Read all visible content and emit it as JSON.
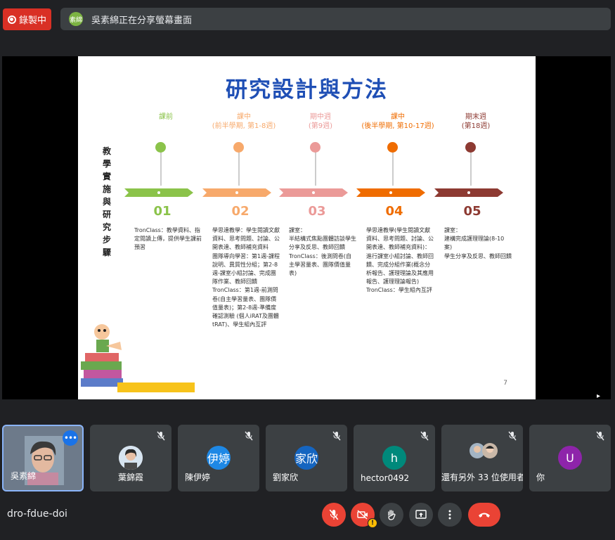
{
  "recording": {
    "label": "錄製中"
  },
  "share_banner": {
    "avatar_text": "素綿",
    "text": "吳素綿正在分享螢幕畫面"
  },
  "slide": {
    "title": "研究設計與方法",
    "side_label": "教學實施與研究步驟",
    "page_number": "7",
    "stages": [
      {
        "phase": "課前",
        "num": "01",
        "color": "#8bc34a",
        "desc": "TronClass：教學資料、指定閱讀上傳，提供學生課前預習"
      },
      {
        "phase": "課中\n(前半學期, 第1-8週)",
        "num": "02",
        "color": "#f7a96b",
        "desc": "學思達教學：學生閱讀文獻資料、思考問題、討論、公開表達、教師補充資料\n團隊導向學習：第1週-課程說明、異質性分組；第2-8週-課室小組討論、完成團隊作業、教師回饋\nTronClass：第1週-前測問卷(自主學習量表、團隊價值量表)；第2-8週-準備度確認測驗 (個人iRAT及團體tRAT)、學生組內互評"
      },
      {
        "phase": "期中週\n(第9週)",
        "num": "03",
        "color": "#eb9a98",
        "desc": "課室：\n半結構式焦點團體訪談學生分享及反思、教師回饋\n TronClass：後測問卷(自主學習量表、團隊價值量表)"
      },
      {
        "phase": "課中\n(後半學期, 第10-17週)",
        "num": "04",
        "color": "#ef6c00",
        "desc": "學思達教學(學生閱讀文獻資料、思考問題、討論、公開表達、教師補充資料)：進行課室小組討論、教師回饋、完成分組作業(概念分析報告、護理理論及其應用報告、護理理論報告)\nTronClass：學生組內互評"
      },
      {
        "phase": "期末週\n(第18週)",
        "num": "05",
        "color": "#8d3a32",
        "desc": "課室：\n建構完成護理理論(8-10案)\n學生分享及反思、教師回饋"
      }
    ]
  },
  "participants": [
    {
      "name": "吳素綿",
      "type": "video",
      "self_options_icon": "more-vert-icon"
    },
    {
      "name": "葉錦霞",
      "type": "photo",
      "muted": true
    },
    {
      "name": "陳伊婷",
      "type": "initial",
      "initial": "伊婷",
      "color": "#1e88e5",
      "muted": true
    },
    {
      "name": "劉家欣",
      "type": "initial",
      "initial": "家欣",
      "color": "#1565c0",
      "muted": true
    },
    {
      "name": "hector0492",
      "type": "initial",
      "initial": "h",
      "color": "#00897b",
      "muted": true
    },
    {
      "name": "還有另外 33 位使用者",
      "type": "group",
      "muted": true
    },
    {
      "name": "你",
      "type": "initial",
      "initial": "U",
      "color": "#8e24aa",
      "muted": true
    }
  ],
  "controls": {
    "meeting_code": "dro-fdue-doi",
    "camera_badge": "!",
    "buttons": [
      "mic-off-icon",
      "camera-off-icon",
      "raise-hand-icon",
      "present-icon",
      "more-options-icon",
      "hang-up-icon"
    ]
  },
  "colors": {
    "record_red": "#d93025",
    "accent_blue": "#8ab4f8",
    "background": "#202124",
    "tile": "#3c4043"
  }
}
